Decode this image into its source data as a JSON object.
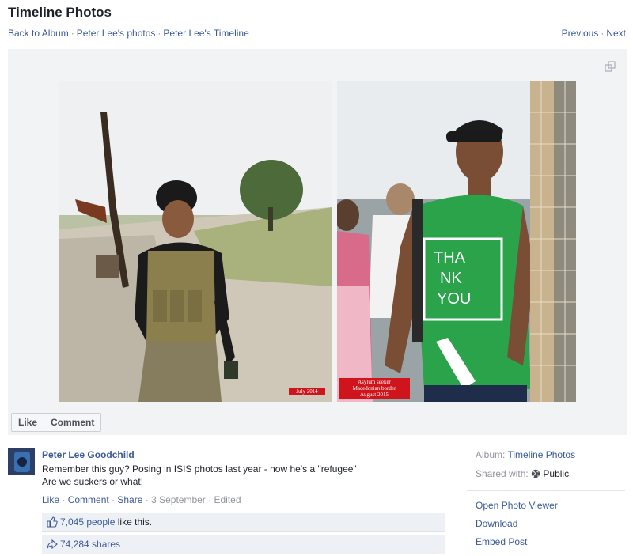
{
  "header": {
    "title": "Timeline Photos",
    "breadcrumbs": [
      "Back to Album",
      "Peter Lee's photos",
      "Peter Lee's Timeline"
    ],
    "previous_label": "Previous",
    "next_label": "Next"
  },
  "photo": {
    "left_tag": "July 2014",
    "right_tag_lines": [
      "Asylum seeker",
      "Macedonian border",
      "August 2015"
    ],
    "shirt_text": "THANK YOU"
  },
  "photo_actions": {
    "like_label": "Like",
    "comment_label": "Comment"
  },
  "post": {
    "author": "Peter Lee Goodchild",
    "caption_line1": "Remember this guy? Posing in ISIS photos last year - now he's a \"refugee\"",
    "caption_line2": "Are we suckers or what!",
    "actions": [
      "Like",
      "Comment",
      "Share"
    ],
    "date": "3 September",
    "edited": "Edited",
    "likes_count": "7,045 people",
    "likes_suffix": "like this.",
    "shares": "74,284 shares"
  },
  "sidebar": {
    "album_label": "Album:",
    "album_value": "Timeline Photos",
    "shared_label": "Shared with:",
    "shared_value": "Public",
    "links": [
      "Open Photo Viewer",
      "Download",
      "Embed Post"
    ]
  },
  "colors": {
    "link": "#3b5998",
    "tag_red": "#d0141b",
    "shirt_green": "#2aa34a"
  }
}
